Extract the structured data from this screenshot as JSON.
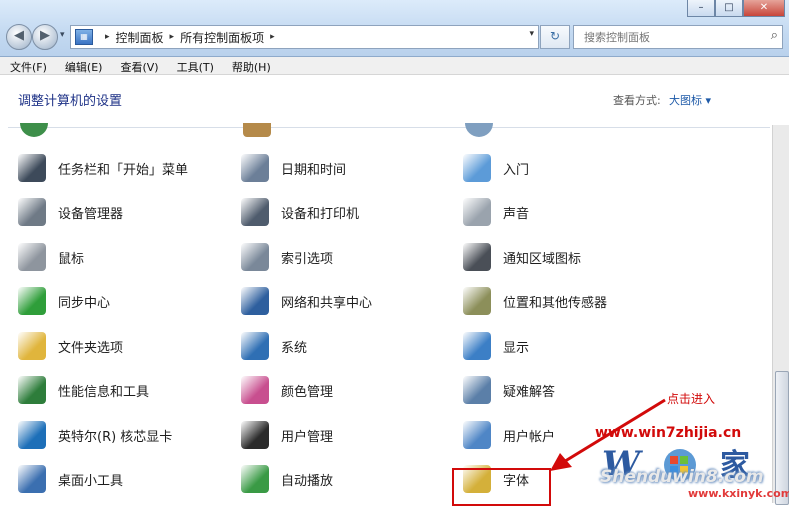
{
  "window": {
    "minimize": "–",
    "maximize": "□",
    "close": "✕"
  },
  "nav": {
    "back": "◀",
    "forward": "▶",
    "dropdown": "▾",
    "refresh": "↻"
  },
  "address": {
    "breadcrumbs": [
      "控制面板",
      "所有控制面板项"
    ],
    "separator": "▸",
    "dropdown": "▾"
  },
  "search": {
    "placeholder": "搜索控制面板",
    "icon": "search-icon"
  },
  "menu": [
    "文件(F)",
    "编辑(E)",
    "查看(V)",
    "工具(T)",
    "帮助(H)"
  ],
  "header": {
    "title": "调整计算机的设置",
    "view_by_label": "查看方式:",
    "view_by_value": "大图标 ▾"
  },
  "items": [
    {
      "label": "任务栏和「开始」菜单",
      "icon": "taskbar-icon",
      "color": "#3d4a5a"
    },
    {
      "label": "日期和时间",
      "icon": "clock-icon",
      "color": "#6c7f98"
    },
    {
      "label": "入门",
      "icon": "getting-started-icon",
      "color": "#5c9bd8"
    },
    {
      "label": "设备管理器",
      "icon": "device-manager-icon",
      "color": "#6f7a86"
    },
    {
      "label": "设备和打印机",
      "icon": "printer-icon",
      "color": "#4f5c6d"
    },
    {
      "label": "声音",
      "icon": "speaker-icon",
      "color": "#9aa3ad"
    },
    {
      "label": "鼠标",
      "icon": "mouse-icon",
      "color": "#8e959e"
    },
    {
      "label": "索引选项",
      "icon": "index-icon",
      "color": "#7a8899"
    },
    {
      "label": "通知区域图标",
      "icon": "notification-icon",
      "color": "#4a4f57"
    },
    {
      "label": "同步中心",
      "icon": "sync-icon",
      "color": "#2f9e3a"
    },
    {
      "label": "网络和共享中心",
      "icon": "network-icon",
      "color": "#2e5f9e"
    },
    {
      "label": "位置和其他传感器",
      "icon": "sensor-icon",
      "color": "#8c8f5a"
    },
    {
      "label": "文件夹选项",
      "icon": "folder-icon",
      "color": "#e0b53c"
    },
    {
      "label": "系统",
      "icon": "system-icon",
      "color": "#2f6fb4"
    },
    {
      "label": "显示",
      "icon": "display-icon",
      "color": "#3c7fc6"
    },
    {
      "label": "性能信息和工具",
      "icon": "performance-icon",
      "color": "#2e7d3b"
    },
    {
      "label": "颜色管理",
      "icon": "color-icon",
      "color": "#c84f8f"
    },
    {
      "label": "疑难解答",
      "icon": "troubleshoot-icon",
      "color": "#5b7fa8"
    },
    {
      "label": "英特尔(R) 核芯显卡",
      "icon": "intel-graphics-icon",
      "color": "#1d6fb8"
    },
    {
      "label": "用户管理",
      "icon": "user-manage-icon",
      "color": "#2b2b2b"
    },
    {
      "label": "用户帐户",
      "icon": "user-accounts-icon",
      "color": "#4f86c6"
    },
    {
      "label": "桌面小工具",
      "icon": "gadgets-icon",
      "color": "#3b6fb0"
    },
    {
      "label": "自动播放",
      "icon": "autoplay-icon",
      "color": "#3a9a45"
    },
    {
      "label": "字体",
      "icon": "fonts-icon",
      "color": "#d4b03a"
    }
  ],
  "annotation": {
    "text": "点击进入",
    "color": "#d20a0a"
  },
  "watermark": {
    "site1": "www.win7zhijia.cn",
    "site2": "Shenduwin8.com",
    "site3": "www.kxinyk.com"
  }
}
